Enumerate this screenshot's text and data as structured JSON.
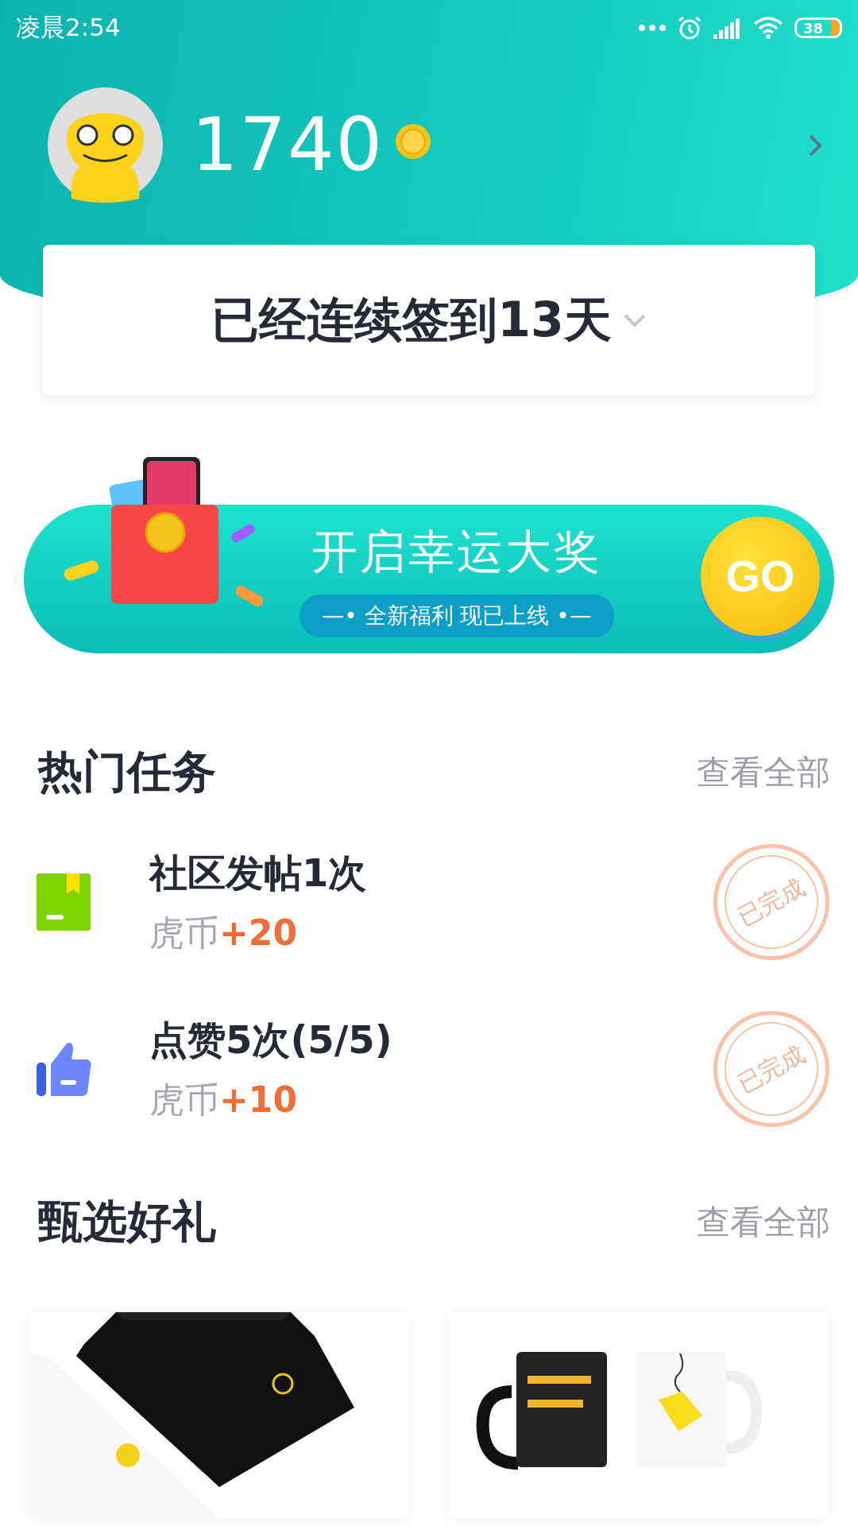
{
  "status_bar": {
    "time": "凌晨2:54",
    "battery": "38"
  },
  "profile": {
    "coins": "1740"
  },
  "checkin": {
    "text": "已经连续签到13天"
  },
  "banner": {
    "title": "开启幸运大奖",
    "subtitle": "—• 全新福利 现已上线 •—",
    "button": "GO"
  },
  "tasks": {
    "title": "热门任务",
    "more": "查看全部",
    "items": [
      {
        "kind": "post",
        "title": "社区发帖1次",
        "reward_label": "虎币",
        "reward_amount": "+20",
        "status": "已完成",
        "completed": true
      },
      {
        "kind": "like",
        "title": "点赞5次(5/5)",
        "reward_label": "虎币",
        "reward_amount": "+10",
        "status": "已完成",
        "completed": true
      }
    ]
  },
  "gifts": {
    "title": "甄选好礼",
    "more": "查看全部"
  }
}
